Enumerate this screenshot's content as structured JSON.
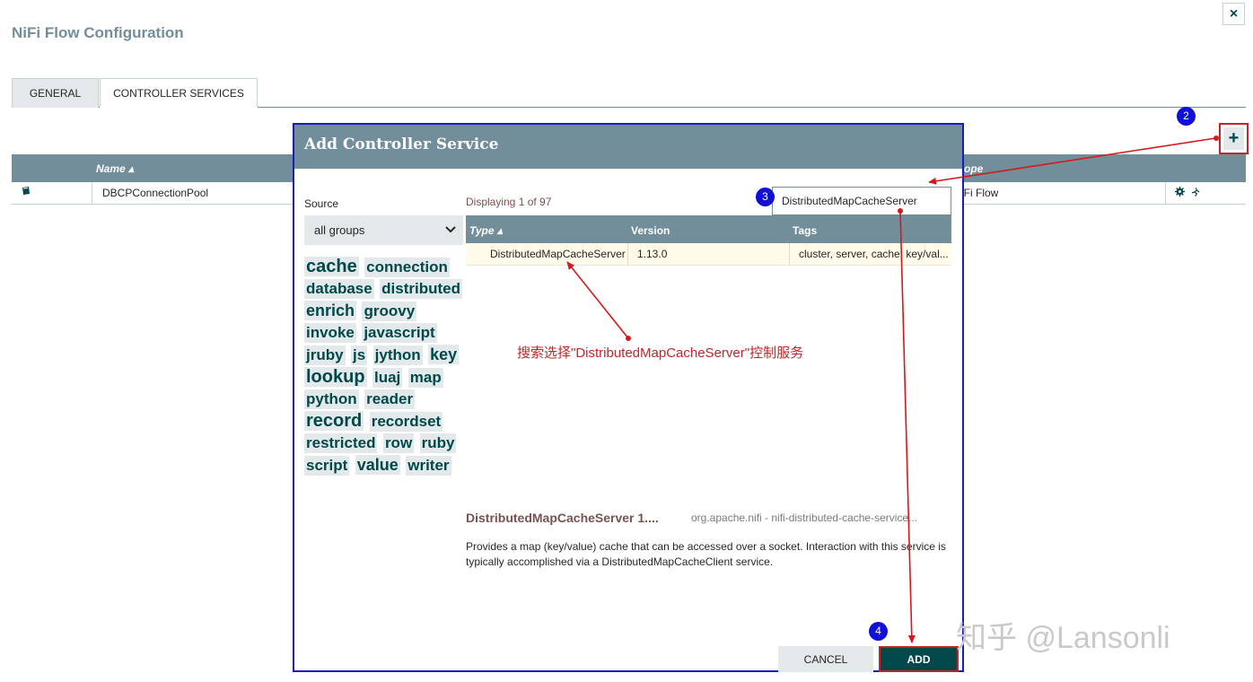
{
  "page": {
    "title": "NiFi Flow Configuration",
    "close_icon": "×"
  },
  "tabs": [
    {
      "label": "GENERAL",
      "active": false
    },
    {
      "label": "CONTROLLER SERVICES",
      "active": true
    }
  ],
  "toolbar": {
    "add_icon": "+"
  },
  "badges": {
    "two": "2",
    "three": "3",
    "four": "4"
  },
  "services_table": {
    "columns": {
      "name": "Name ▴",
      "scope": "ope"
    },
    "rows": [
      {
        "name": "DBCPConnectionPool",
        "scope": "iFi Flow"
      }
    ]
  },
  "dialog": {
    "title": "Add Controller Service",
    "source_label": "Source",
    "source_value": "all groups",
    "tags": [
      {
        "label": "cache",
        "size": 20
      },
      {
        "label": "connection",
        "size": 17
      },
      {
        "label": "database",
        "size": 17
      },
      {
        "label": "distributed",
        "size": 17
      },
      {
        "label": "enrich",
        "size": 18
      },
      {
        "label": "groovy",
        "size": 17
      },
      {
        "label": "invoke",
        "size": 17
      },
      {
        "label": "javascript",
        "size": 17
      },
      {
        "label": "jruby",
        "size": 17
      },
      {
        "label": "js",
        "size": 17
      },
      {
        "label": "jython",
        "size": 17
      },
      {
        "label": "key",
        "size": 18
      },
      {
        "label": "lookup",
        "size": 20
      },
      {
        "label": "luaj",
        "size": 17
      },
      {
        "label": "map",
        "size": 17
      },
      {
        "label": "python",
        "size": 17
      },
      {
        "label": "reader",
        "size": 17
      },
      {
        "label": "record",
        "size": 20
      },
      {
        "label": "recordset",
        "size": 17
      },
      {
        "label": "restricted",
        "size": 17
      },
      {
        "label": "row",
        "size": 17
      },
      {
        "label": "ruby",
        "size": 17
      },
      {
        "label": "script",
        "size": 17
      },
      {
        "label": "value",
        "size": 18
      },
      {
        "label": "writer",
        "size": 17
      }
    ],
    "displaying": "Displaying 1 of 97",
    "filter_value": "DistributedMapCacheServer",
    "columns": {
      "type": "Type ▴",
      "version": "Version",
      "tags": "Tags"
    },
    "rows": [
      {
        "type": "DistributedMapCacheServer",
        "version": "1.13.0",
        "tags": "cluster, server, cache, key/val..."
      }
    ],
    "annotation": "搜索选择\"DistributedMapCacheServer\"控制服务",
    "detail_title": "DistributedMapCacheServer 1....",
    "detail_bundle": "org.apache.nifi - nifi-distributed-cache-service...",
    "detail_description": "Provides a map (key/value) cache that can be accessed over a socket. Interaction with this service is typically accomplished via a DistributedMapCacheClient service.",
    "cancel_label": "CANCEL",
    "add_label": "ADD"
  },
  "watermark": "知乎 @Lansonli",
  "colors": {
    "header": "#728e9b",
    "accent": "#004849",
    "annotation": "#c0262a",
    "badge": "#1010d8"
  }
}
